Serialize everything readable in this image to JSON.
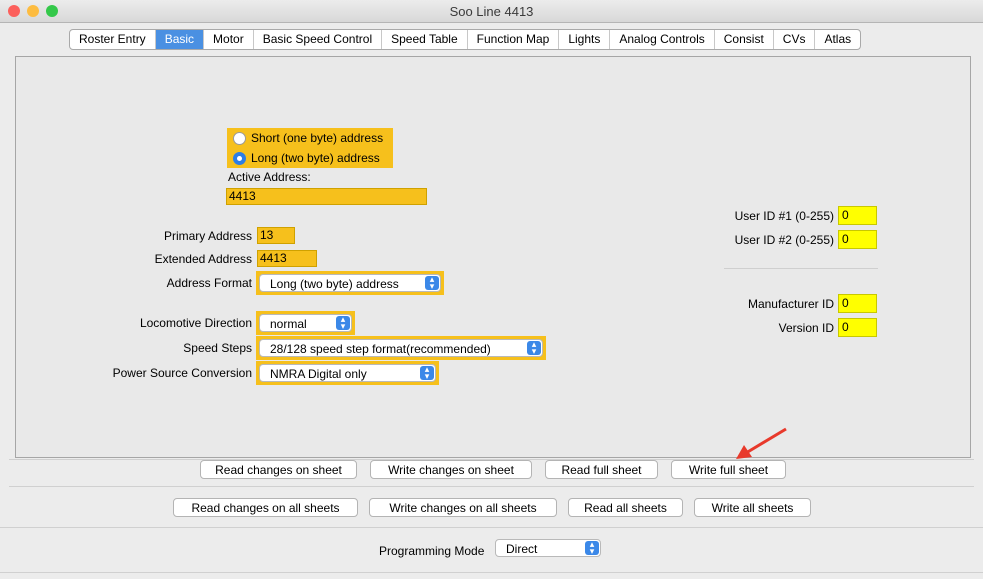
{
  "window": {
    "title": "Soo Line 4413"
  },
  "tabs": [
    "Roster Entry",
    "Basic",
    "Motor",
    "Basic Speed Control",
    "Speed Table",
    "Function Map",
    "Lights",
    "Analog Controls",
    "Consist",
    "CVs",
    "Atlas"
  ],
  "active_tab": "Basic",
  "address_mode": {
    "short_label": "Short (one byte) address",
    "long_label": "Long (two byte) address",
    "selected": "long"
  },
  "active_address": {
    "label": "Active Address:",
    "value": "4413"
  },
  "primary_address": {
    "label": "Primary Address",
    "value": "13"
  },
  "extended_address": {
    "label": "Extended Address",
    "value": "4413"
  },
  "address_format": {
    "label": "Address Format",
    "value": "Long (two byte) address"
  },
  "locomotive_direction": {
    "label": "Locomotive Direction",
    "value": "normal"
  },
  "speed_steps": {
    "label": "Speed Steps",
    "value": "28/128 speed step format(recommended)"
  },
  "power_source": {
    "label": "Power Source Conversion",
    "value": "NMRA Digital only"
  },
  "user_id1": {
    "label": "User ID #1 (0-255)",
    "value": "0"
  },
  "user_id2": {
    "label": "User ID #2 (0-255)",
    "value": "0"
  },
  "manufacturer_id": {
    "label": "Manufacturer ID",
    "value": "0"
  },
  "version_id": {
    "label": "Version ID",
    "value": "0"
  },
  "sheet_buttons": {
    "read_changes": "Read changes on sheet",
    "write_changes": "Write changes on sheet",
    "read_full": "Read full sheet",
    "write_full": "Write full sheet"
  },
  "all_buttons": {
    "read_changes_all": "Read changes on all sheets",
    "write_changes_all": "Write changes on all sheets",
    "read_all": "Read all sheets",
    "write_all": "Write all sheets"
  },
  "programming_mode": {
    "label": "Programming Mode",
    "value": "Direct"
  },
  "colors": {
    "highlight": "#f6c01c",
    "yellow_field": "#ffff00",
    "accent": "#3b88e8",
    "arrow": "#e8392b"
  }
}
